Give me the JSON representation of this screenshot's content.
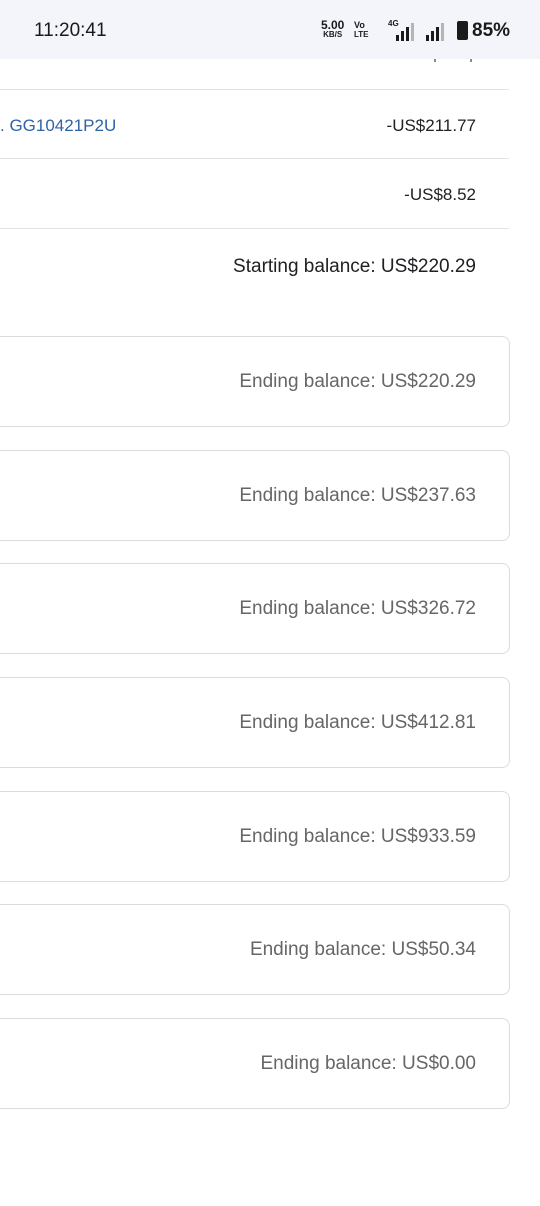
{
  "status_bar": {
    "time": "11:20:41",
    "net_speed_value": "5.00",
    "net_speed_unit": "KB/S",
    "volte_top": "Vo",
    "volte_bottom": "LTE",
    "network_type": "4G",
    "battery": "85%"
  },
  "transactions": [
    {
      "reference": ". GG10421P2U",
      "amount": "-US$211.77"
    },
    {
      "reference": "",
      "amount": "-US$8.52"
    }
  ],
  "starting_balance": "Starting balance: US$220.29",
  "statements": [
    {
      "ending_balance": "Ending balance: US$220.29"
    },
    {
      "ending_balance": "Ending balance: US$237.63"
    },
    {
      "ending_balance": "Ending balance: US$326.72"
    },
    {
      "ending_balance": "Ending balance: US$412.81"
    },
    {
      "ending_balance": "Ending balance: US$933.59"
    },
    {
      "ending_balance": "Ending balance: US$50.34"
    },
    {
      "ending_balance": "Ending balance: US$0.00"
    }
  ]
}
